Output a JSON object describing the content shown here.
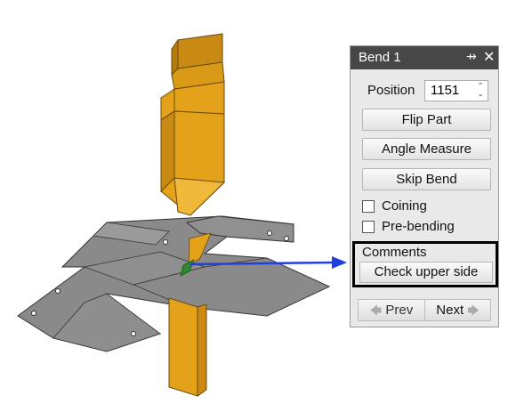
{
  "panel": {
    "title": "Bend 1",
    "pin_icon": "⇸",
    "close_icon": "✕",
    "position_label": "Position",
    "position_value": "1151",
    "flip_part": "Flip Part",
    "angle_measure": "Angle Measure",
    "skip_bend": "Skip Bend",
    "coining": "Coining",
    "pre_bending": "Pre-bending",
    "comments_label": "Comments",
    "comment_button": "Check upper side",
    "prev": "Prev",
    "next": "Next"
  },
  "colors": {
    "tool": "#e3a21a",
    "sheet": "#8a8a8a",
    "bend_line": "#2e8a2e",
    "arrow": "#1f3fe0",
    "title_bar": "#474747"
  }
}
